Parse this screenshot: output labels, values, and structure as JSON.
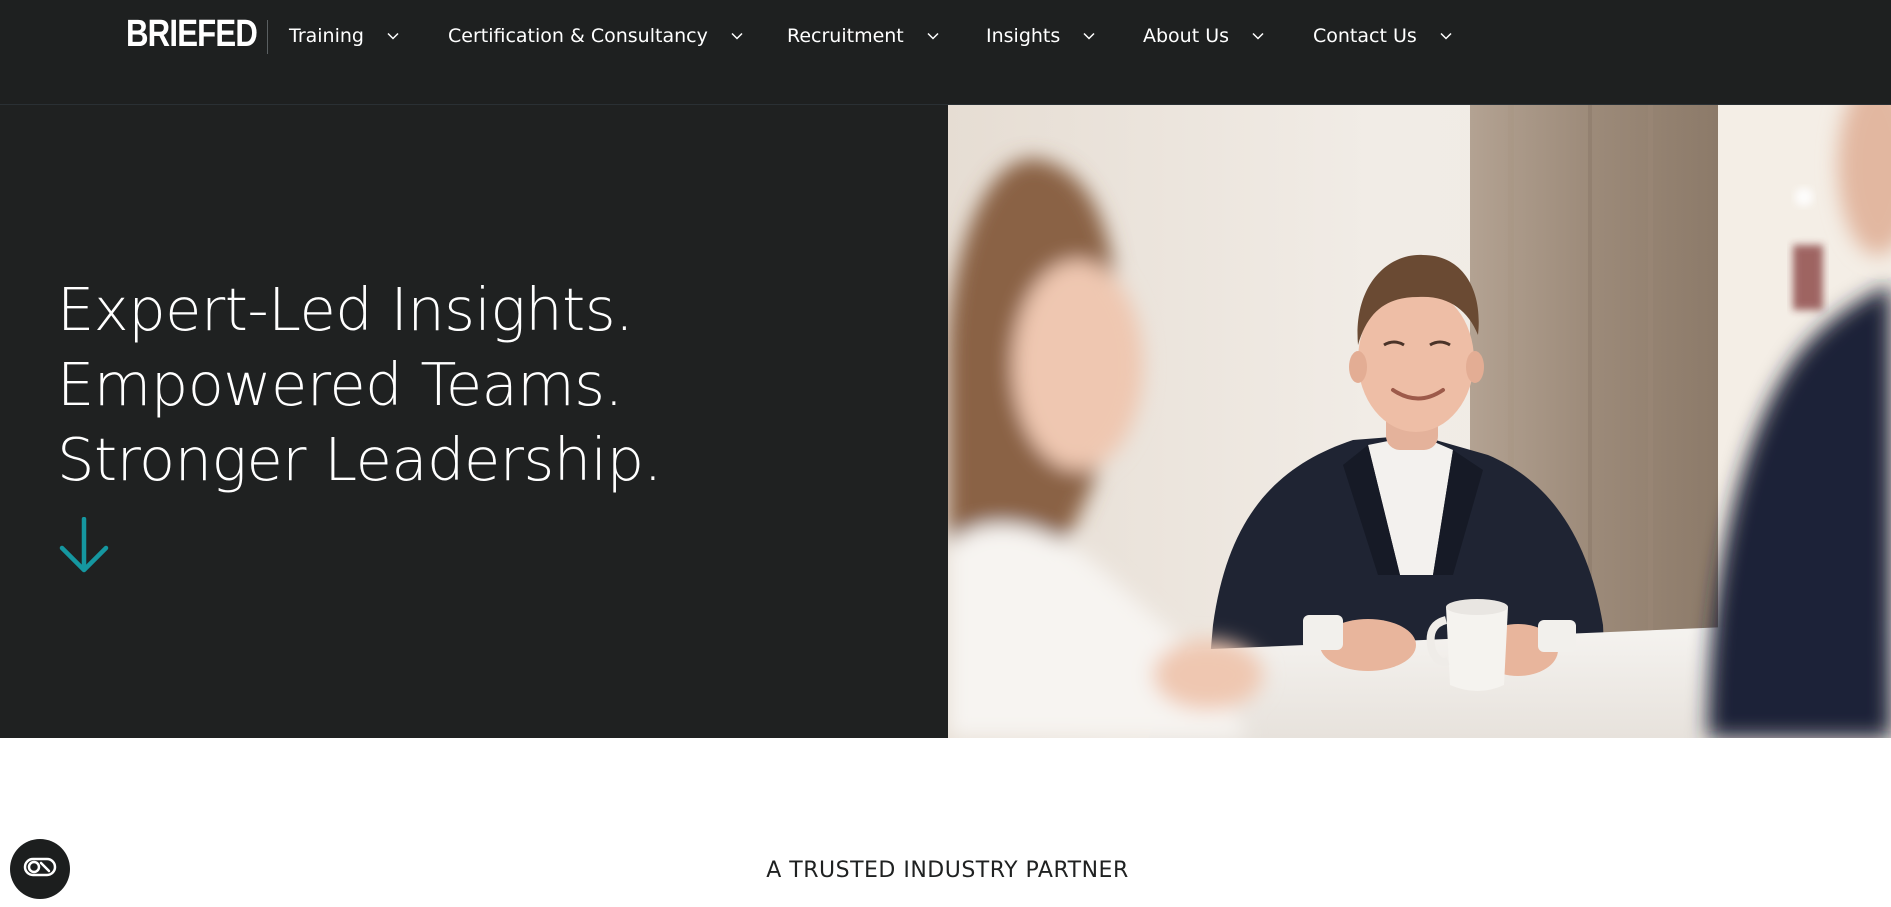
{
  "brand": {
    "logo_text": "BRIEFED"
  },
  "nav": {
    "items": [
      {
        "label": "Training",
        "icon": "chevron-down-icon"
      },
      {
        "label": "Certification & Consultancy",
        "icon": "chevron-down-icon"
      },
      {
        "label": "Recruitment",
        "icon": "chevron-down-icon"
      },
      {
        "label": "Insights",
        "icon": "chevron-down-icon"
      },
      {
        "label": "About Us",
        "icon": "chevron-down-icon"
      },
      {
        "label": "Contact Us",
        "icon": "chevron-down-icon"
      }
    ]
  },
  "hero": {
    "headline_lines": [
      "Expert-Led Insights.",
      "Empowered Teams.",
      "Stronger Leadership."
    ],
    "scroll_icon": "arrow-down-icon",
    "image_subject": "photo-meeting-people"
  },
  "section": {
    "eyebrow": "A TRUSTED INDUSTRY PARTNER"
  },
  "widgets": {
    "accessibility_icon": "accessibility-toggle-icon"
  },
  "colors": {
    "header_bg": "#1e2020",
    "hero_bg": "#1f2121",
    "accent": "#1597a0",
    "text_light": "#ffffff",
    "text_dark": "#1f2121"
  }
}
